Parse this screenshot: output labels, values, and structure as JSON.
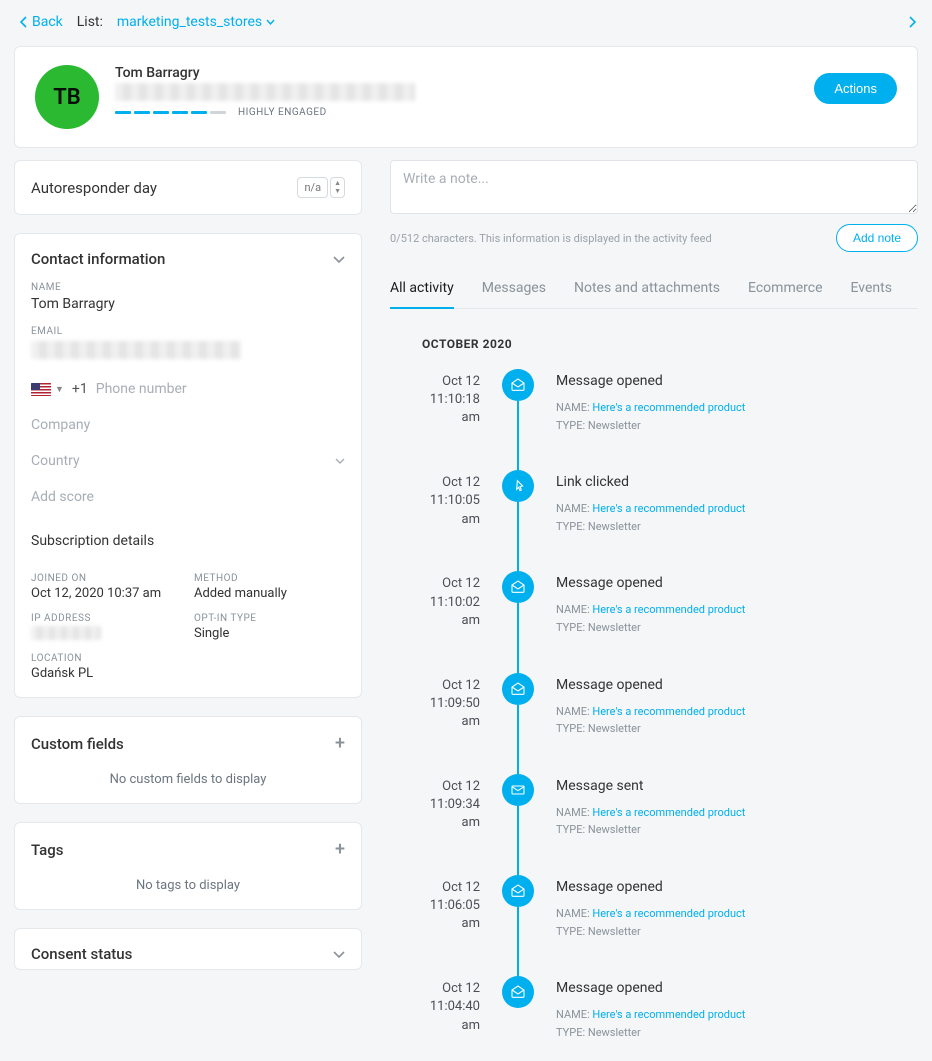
{
  "topbar": {
    "back_label": "Back",
    "list_label": "List:",
    "list_name": "marketing_tests_stores"
  },
  "header": {
    "avatar_initials": "TB",
    "name": "Tom Barragry",
    "engagement_label": "HIGHLY ENGAGED",
    "actions_label": "Actions"
  },
  "autoresponder": {
    "title": "Autoresponder day",
    "value": "n/a"
  },
  "contact_info": {
    "title": "Contact information",
    "labels": {
      "name": "NAME",
      "email": "EMAIL",
      "phone_code": "+1",
      "phone_placeholder": "Phone number",
      "company_placeholder": "Company",
      "country_placeholder": "Country",
      "score_placeholder": "Add score"
    },
    "name": "Tom Barragry",
    "subscription": {
      "title": "Subscription details",
      "joined_label": "JOINED ON",
      "joined_value": "Oct 12, 2020 10:37 am",
      "method_label": "METHOD",
      "method_value": "Added manually",
      "ip_label": "IP ADDRESS",
      "optin_label": "OPT-IN TYPE",
      "optin_value": "Single",
      "location_label": "LOCATION",
      "location_value": "Gdańsk PL"
    }
  },
  "custom_fields": {
    "title": "Custom fields",
    "empty": "No custom fields to display"
  },
  "tags_panel": {
    "title": "Tags",
    "empty": "No tags to display"
  },
  "consent": {
    "title": "Consent status"
  },
  "note": {
    "placeholder": "Write a note...",
    "counter": "0/512 characters. This information is displayed in the activity feed",
    "add_label": "Add note"
  },
  "tabs": {
    "all": "All activity",
    "messages": "Messages",
    "notes": "Notes and attachments",
    "ecommerce": "Ecommerce",
    "events": "Events"
  },
  "feed": {
    "month": "OCTOBER 2020",
    "meta_name_label": "NAME:",
    "meta_type_label": "TYPE:",
    "link_name": "Here's a recommended product",
    "type_value": "Newsletter",
    "events": [
      {
        "date": "Oct 12",
        "time": "11:10:18 am",
        "title": "Message opened",
        "icon": "mail-open"
      },
      {
        "date": "Oct 12",
        "time": "11:10:05 am",
        "title": "Link clicked",
        "icon": "link-click"
      },
      {
        "date": "Oct 12",
        "time": "11:10:02 am",
        "title": "Message opened",
        "icon": "mail-open"
      },
      {
        "date": "Oct 12",
        "time": "11:09:50 am",
        "title": "Message opened",
        "icon": "mail-open"
      },
      {
        "date": "Oct 12",
        "time": "11:09:34 am",
        "title": "Message sent",
        "icon": "mail-send"
      },
      {
        "date": "Oct 12",
        "time": "11:06:05 am",
        "title": "Message opened",
        "icon": "mail-open"
      },
      {
        "date": "Oct 12",
        "time": "11:04:40 am",
        "title": "Message opened",
        "icon": "mail-open"
      }
    ]
  }
}
